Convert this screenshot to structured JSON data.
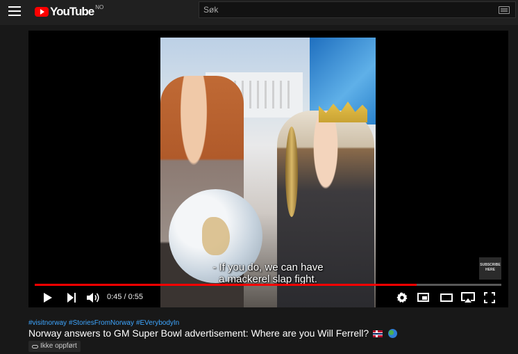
{
  "header": {
    "logo_text": "YouTube",
    "country_code": "NO",
    "search_placeholder": "Søk"
  },
  "player": {
    "subtitle_line1": "- If you do, we can have",
    "subtitle_line2": "a mackerel slap fight.",
    "subscribe_badge_line1": "SUBSCRIBE",
    "subscribe_badge_line2": "HERE",
    "current_time": "0:45",
    "time_separator": " / ",
    "duration": "0:55",
    "progress_fraction": 0.818,
    "progress_color": "#ff0000"
  },
  "video": {
    "hashtags": [
      "#visitnorway",
      "#StoriesFromNorway",
      "#EVerybodyIn"
    ],
    "title": "Norway answers to GM Super Bowl advertisement: Where are you Will Ferrell?",
    "visibility_label": "Ikke oppført"
  },
  "icons": {
    "menu": "hamburger-icon",
    "keyboard": "keyboard-icon",
    "play": "play-icon",
    "next": "next-icon",
    "volume": "volume-icon",
    "settings": "gear-icon",
    "miniplayer": "miniplayer-icon",
    "theater": "theater-icon",
    "airplay": "airplay-icon",
    "fullscreen": "fullscreen-icon",
    "flag": "norway-flag-icon",
    "globe": "globe-icon",
    "link": "link-icon"
  },
  "colors": {
    "background": "#181818",
    "header": "#202020",
    "hashtag": "#3ea6ff",
    "brand_red": "#ff0000"
  }
}
